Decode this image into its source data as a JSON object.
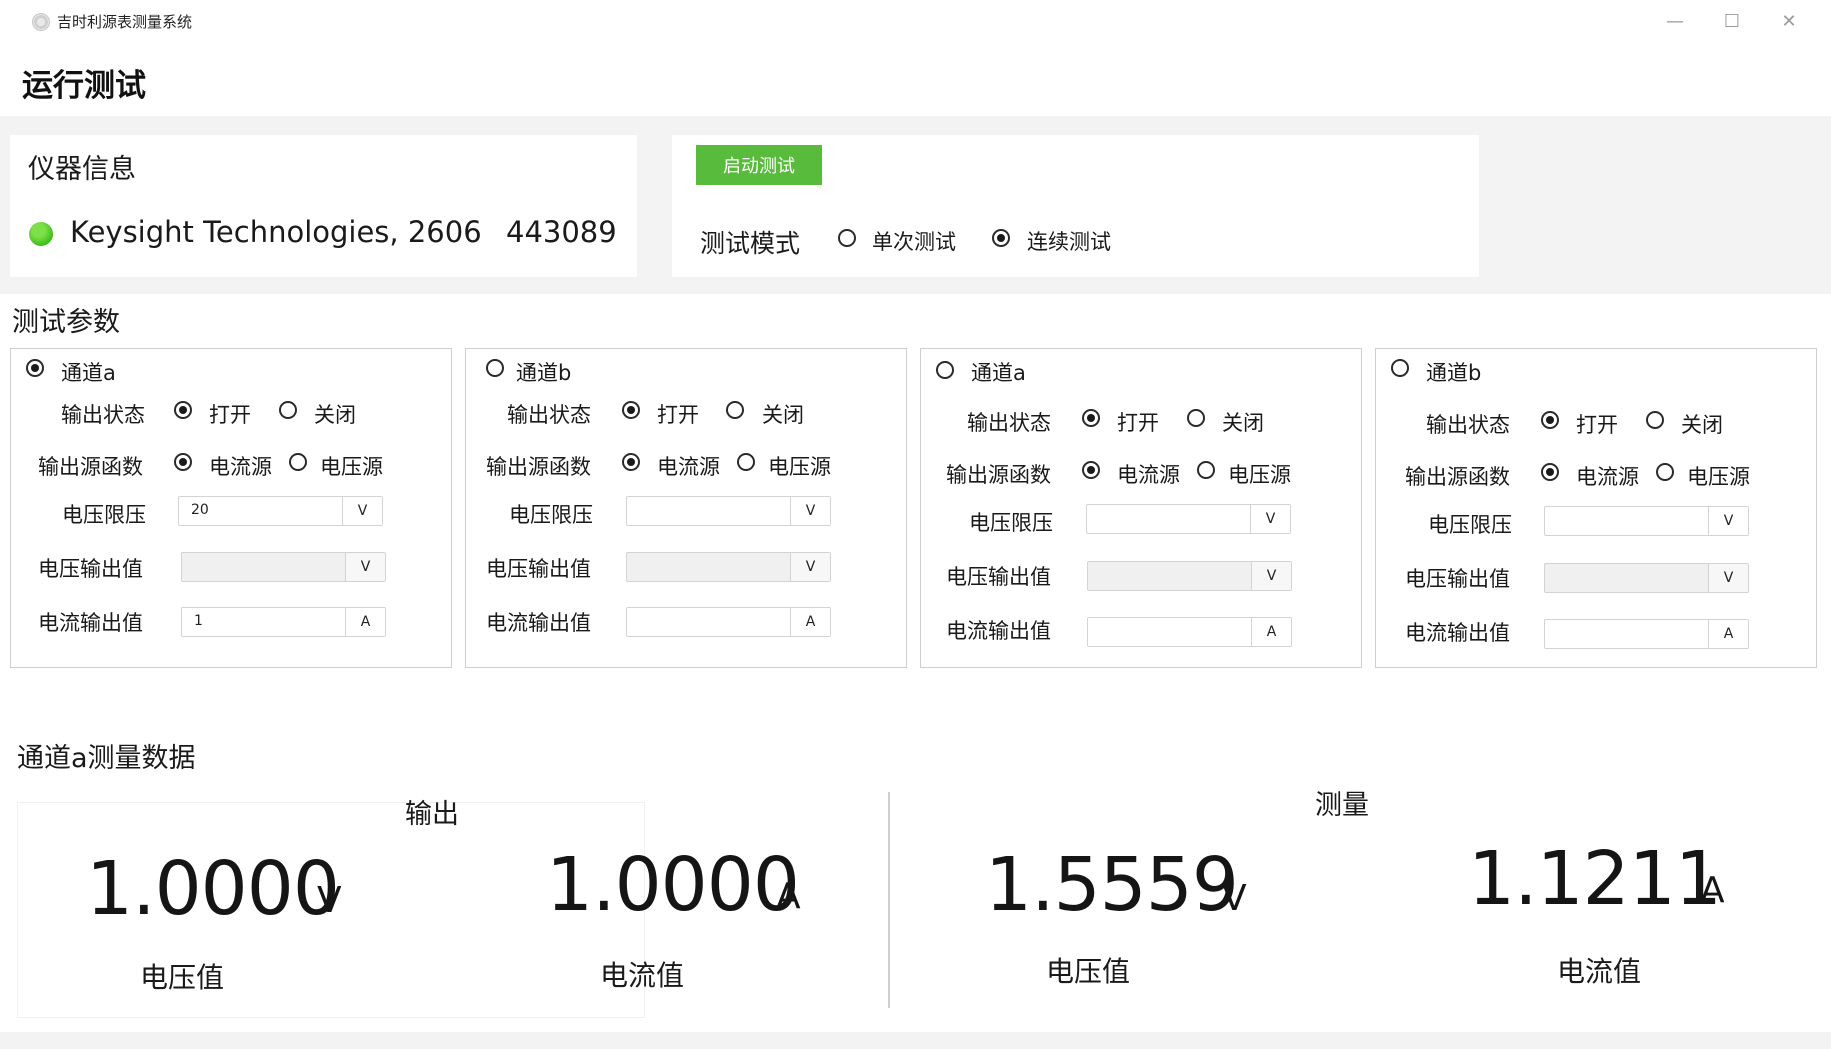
{
  "window": {
    "title": "吉时利源表测量系统",
    "minimize": "—",
    "maximize": "☐",
    "close": "✕"
  },
  "page_title": "运行测试",
  "instrument": {
    "heading": "仪器信息",
    "name": "Keysight Technologies, 2606",
    "serial": "443089",
    "status_color": "#3fbf1a"
  },
  "control": {
    "start_button": "启动测试",
    "mode_label": "测试模式",
    "mode_single": "单次测试",
    "mode_continuous": "连续测试",
    "selected_mode": "continuous",
    "accent": "#58bb3c"
  },
  "params_heading": "测试参数",
  "labels": {
    "output_state": "输出状态",
    "on": "打开",
    "off": "关闭",
    "source_func": "输出源函数",
    "current_source": "电流源",
    "voltage_source": "电压源",
    "voltage_limit": "电压限压",
    "voltage_output": "电压输出值",
    "current_output": "电流输出值",
    "unit_v": "V",
    "unit_a": "A"
  },
  "channels": [
    {
      "name": "通道a",
      "selected": true,
      "output_on": true,
      "func": "current",
      "voltage_limit": "20",
      "voltage_output": "",
      "current_output": "1"
    },
    {
      "name": "通道b",
      "selected": false,
      "output_on": true,
      "func": "current",
      "voltage_limit": "",
      "voltage_output": "",
      "current_output": ""
    },
    {
      "name": "通道a",
      "selected": false,
      "output_on": true,
      "func": "current",
      "voltage_limit": "",
      "voltage_output": "",
      "current_output": ""
    },
    {
      "name": "通道b",
      "selected": false,
      "output_on": true,
      "func": "current",
      "voltage_limit": "",
      "voltage_output": "",
      "current_output": ""
    }
  ],
  "measurement": {
    "heading": "通道a测量数据",
    "output_group": "输出",
    "measure_group": "测量",
    "output_voltage": "1.0000",
    "output_current": "1.0000",
    "measured_voltage": "1.5559",
    "measured_current": "1.1211",
    "unit_v": "V",
    "unit_a": "A",
    "voltage_caption": "电压值",
    "current_caption": "电流值"
  }
}
